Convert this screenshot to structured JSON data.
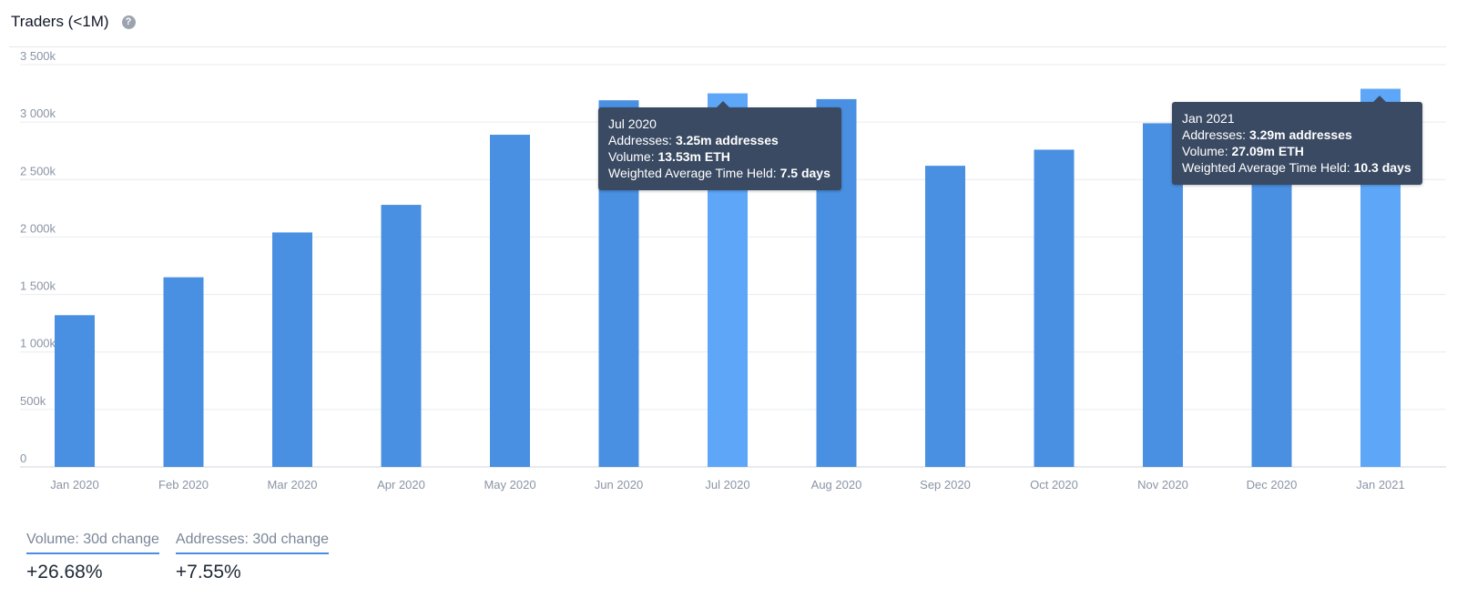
{
  "header": {
    "title": "Traders (<1M)",
    "help_icon": "question-circle-icon"
  },
  "colors": {
    "bar": "#4a90e2",
    "bar_highlight": "#5ea7f8",
    "tooltip_bg": "#3a4a63",
    "grid": "#e8ebef"
  },
  "chart_data": {
    "type": "bar",
    "categories": [
      "Jan 2020",
      "Feb 2020",
      "Mar 2020",
      "Apr 2020",
      "May 2020",
      "Jun 2020",
      "Jul 2020",
      "Aug 2020",
      "Sep 2020",
      "Oct 2020",
      "Nov 2020",
      "Dec 2020",
      "Jan 2021"
    ],
    "values": [
      1320,
      1650,
      2040,
      2280,
      2890,
      3190,
      3250,
      3200,
      2620,
      2760,
      2990,
      3130,
      3290
    ],
    "highlighted": [
      "Jul 2020",
      "Jan 2021"
    ],
    "ylim": [
      0,
      3500
    ],
    "yticks": [
      0,
      500,
      1000,
      1500,
      2000,
      2500,
      3000,
      3500
    ],
    "ytick_labels": [
      "0",
      "500k",
      "1 000k",
      "1 500k",
      "2 000k",
      "2 500k",
      "3 000k",
      "3 500k"
    ],
    "grid": true,
    "title": "",
    "xlabel": "",
    "ylabel": ""
  },
  "tooltips": [
    {
      "category": "Jul 2020",
      "title": "Jul 2020",
      "addresses_label": "Addresses: ",
      "addresses_value": "3.25m addresses",
      "volume_label": "Volume: ",
      "volume_value": "13.53m ETH",
      "time_label": "Weighted Average Time Held: ",
      "time_value": "7.5 days"
    },
    {
      "category": "Jan 2021",
      "title": "Jan 2021",
      "addresses_label": "Addresses: ",
      "addresses_value": "3.29m addresses",
      "volume_label": "Volume: ",
      "volume_value": "27.09m ETH",
      "time_label": "Weighted Average Time Held: ",
      "time_value": "10.3 days"
    }
  ],
  "stats": [
    {
      "label": "Volume: 30d change",
      "value": "+26.68%"
    },
    {
      "label": "Addresses: 30d change",
      "value": "+7.55%"
    }
  ]
}
